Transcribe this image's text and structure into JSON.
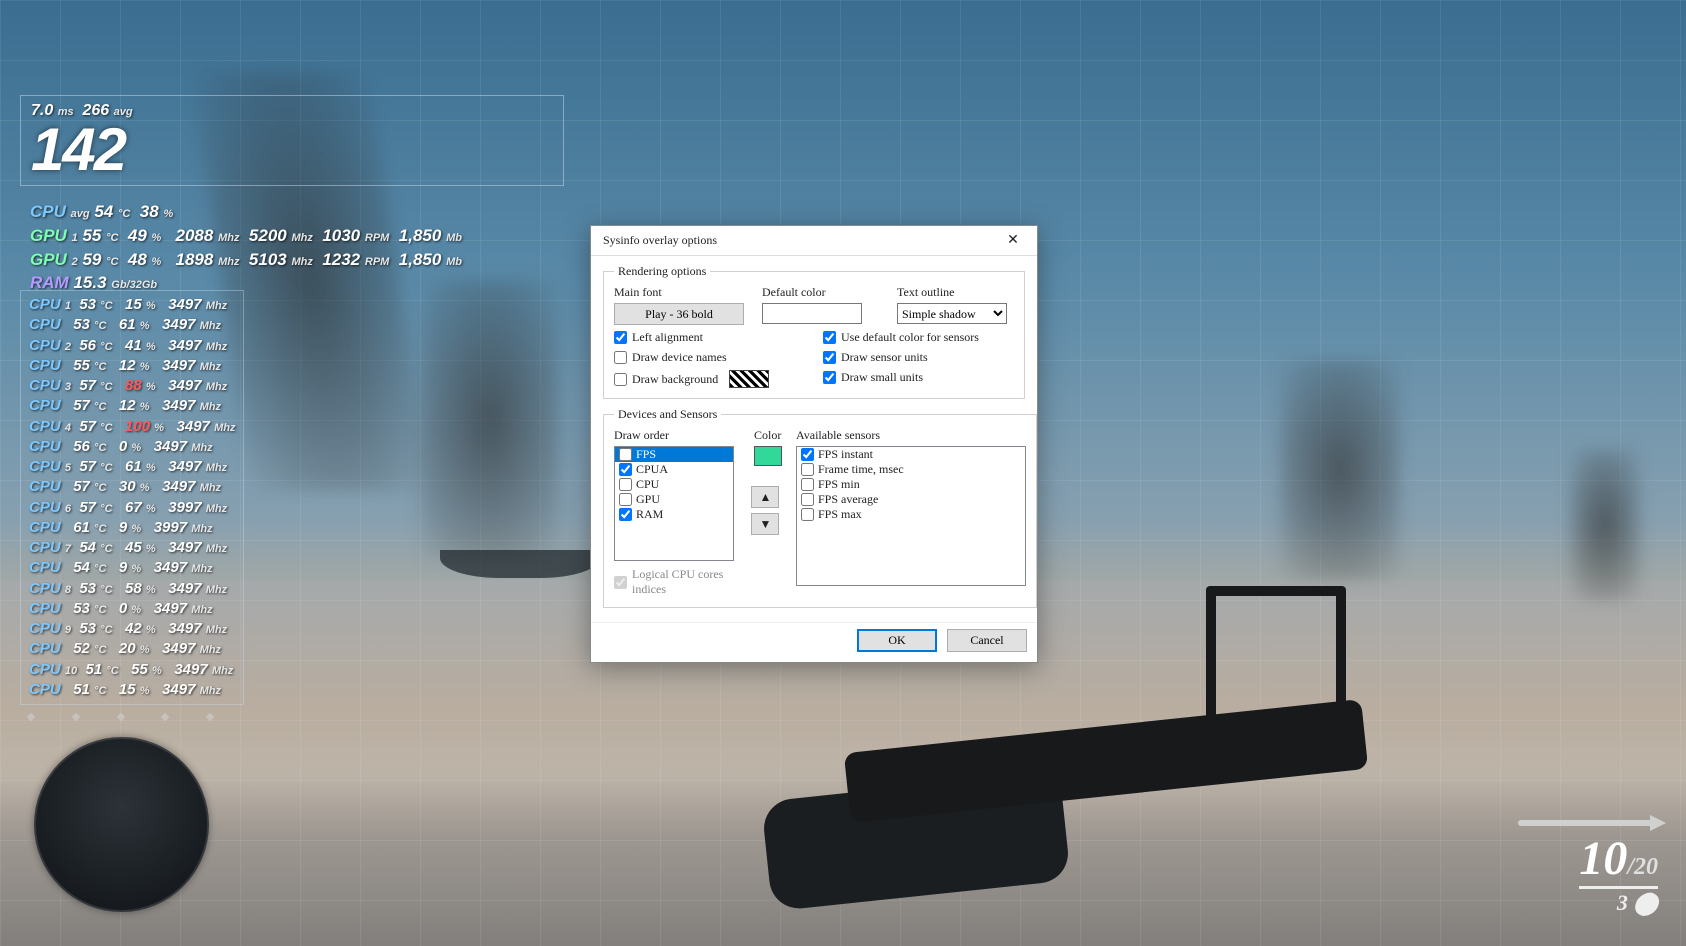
{
  "dialog": {
    "title": "Sysinfo overlay options",
    "rendering_group": "Rendering options",
    "main_font_label": "Main font",
    "main_font_btn": "Play - 36 bold",
    "default_color_label": "Default color",
    "text_outline_label": "Text outline",
    "text_outline_value": "Simple shadow",
    "left_alignment": "Left alignment",
    "use_default_color": "Use default color for sensors",
    "draw_device_names": "Draw device names",
    "draw_sensor_units": "Draw sensor units",
    "draw_background": "Draw background",
    "draw_small_units": "Draw small units",
    "devices_group": "Devices and Sensors",
    "draw_order_label": "Draw order",
    "color_label": "Color",
    "available_label": "Available sensors",
    "draw_order": [
      "FPS",
      "CPUA",
      "CPU",
      "GPU",
      "RAM"
    ],
    "draw_order_checked": [
      false,
      true,
      false,
      false,
      true
    ],
    "draw_order_selected": 0,
    "available": [
      "FPS instant",
      "Frame time, msec",
      "FPS min",
      "FPS average",
      "FPS max"
    ],
    "available_checked": [
      true,
      false,
      false,
      false,
      false
    ],
    "selected_color": "#30d99a",
    "logical_cores": "Logical CPU cores indices",
    "ok": "OK",
    "cancel": "Cancel",
    "up": "▲",
    "down": "▼"
  },
  "osd": {
    "frametime": {
      "ms": "7.0",
      "ms_u": "ms",
      "avg": "266",
      "avg_u": "avg"
    },
    "fps": "142",
    "cpu_avg": {
      "label": "CPU",
      "sub": "avg",
      "temp": "54",
      "temp_u": "°C",
      "load": "38",
      "load_u": "%"
    },
    "gpu": [
      {
        "label": "GPU",
        "idx": "1",
        "temp": "55",
        "load": "49",
        "core": "2088",
        "mem": "5200",
        "rpm": "1030",
        "mb": "1,850"
      },
      {
        "label": "GPU",
        "idx": "2",
        "temp": "59",
        "load": "48",
        "core": "1898",
        "mem": "5103",
        "rpm": "1232",
        "mb": "1,850"
      }
    ],
    "ram": {
      "label": "RAM",
      "val": "15.3",
      "u": "Gb/32Gb"
    },
    "cores": [
      {
        "n": "1",
        "t": "53",
        "l": "15",
        "mhz": "3497",
        "hot": false
      },
      {
        "n": "",
        "t": "53",
        "l": "61",
        "mhz": "3497",
        "hot": false
      },
      {
        "n": "2",
        "t": "56",
        "l": "41",
        "mhz": "3497",
        "hot": false
      },
      {
        "n": "",
        "t": "55",
        "l": "12",
        "mhz": "3497",
        "hot": false
      },
      {
        "n": "3",
        "t": "57",
        "l": "88",
        "mhz": "3497",
        "hot": true
      },
      {
        "n": "",
        "t": "57",
        "l": "12",
        "mhz": "3497",
        "hot": false
      },
      {
        "n": "4",
        "t": "57",
        "l": "100",
        "mhz": "3497",
        "hot": true
      },
      {
        "n": "",
        "t": "56",
        "l": "0",
        "mhz": "3497",
        "hot": false
      },
      {
        "n": "5",
        "t": "57",
        "l": "61",
        "mhz": "3497",
        "hot": false
      },
      {
        "n": "",
        "t": "57",
        "l": "30",
        "mhz": "3497",
        "hot": false
      },
      {
        "n": "6",
        "t": "57",
        "l": "67",
        "mhz": "3997",
        "hot": false
      },
      {
        "n": "",
        "t": "61",
        "l": "9",
        "mhz": "3997",
        "hot": false
      },
      {
        "n": "7",
        "t": "54",
        "l": "45",
        "mhz": "3497",
        "hot": false
      },
      {
        "n": "",
        "t": "54",
        "l": "9",
        "mhz": "3497",
        "hot": false
      },
      {
        "n": "8",
        "t": "53",
        "l": "58",
        "mhz": "3497",
        "hot": false
      },
      {
        "n": "",
        "t": "53",
        "l": "0",
        "mhz": "3497",
        "hot": false
      },
      {
        "n": "9",
        "t": "53",
        "l": "42",
        "mhz": "3497",
        "hot": false
      },
      {
        "n": "",
        "t": "52",
        "l": "20",
        "mhz": "3497",
        "hot": false
      },
      {
        "n": "10",
        "t": "51",
        "l": "55",
        "mhz": "3497",
        "hot": false
      },
      {
        "n": "",
        "t": "51",
        "l": "15",
        "mhz": "3497",
        "hot": false
      }
    ]
  },
  "hud": {
    "ammo_cur": "10",
    "ammo_sep": "/",
    "ammo_res": "20",
    "grenade": "3"
  }
}
